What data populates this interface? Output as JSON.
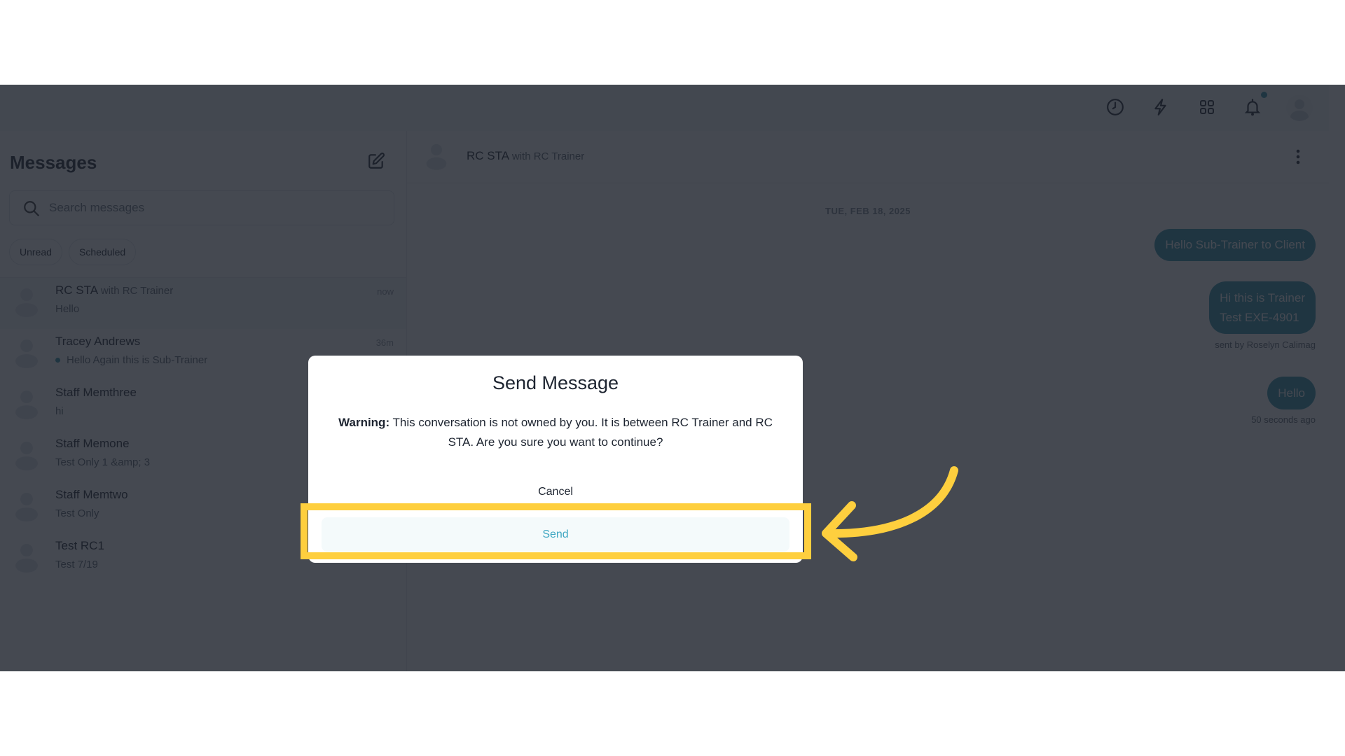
{
  "topbar": {
    "icons": [
      "history-clock-icon",
      "lightning-bolt-icon",
      "apps-grid-icon",
      "notifications-bell-icon",
      "user-avatar"
    ],
    "notification_badge": true
  },
  "sidebar": {
    "title": "Messages",
    "search": {
      "placeholder": "Search messages",
      "value": ""
    },
    "filters": [
      "Unread",
      "Scheduled"
    ],
    "conversations": [
      {
        "name": "RC STA",
        "with": "with RC Trainer",
        "preview": "Hello",
        "time": "now",
        "selected": true,
        "unread": false
      },
      {
        "name": "Tracey Andrews",
        "with": "",
        "preview": "Hello Again this is Sub-Trainer",
        "time": "36m",
        "selected": false,
        "unread": true
      },
      {
        "name": "Staff Memthree",
        "with": "",
        "preview": "hi",
        "time": "",
        "selected": false,
        "unread": false
      },
      {
        "name": "Staff Memone",
        "with": "",
        "preview": "Test Only 1 &amp; 3",
        "time": "",
        "selected": false,
        "unread": false
      },
      {
        "name": "Staff Memtwo",
        "with": "",
        "preview": "Test Only",
        "time": "",
        "selected": false,
        "unread": false
      },
      {
        "name": "Test RC1",
        "with": "",
        "preview": "Test 7/19",
        "time": "",
        "selected": false,
        "unread": false
      }
    ]
  },
  "chat": {
    "title": "RC STA",
    "title_with": "with RC Trainer",
    "date": "TUE, FEB 18, 2025",
    "messages": [
      {
        "lines": [
          "Hello Sub-Trainer to Client"
        ],
        "meta": ""
      },
      {
        "lines": [
          "Hi this is Trainer",
          "Test EXE-4901"
        ],
        "meta": "sent by Roselyn Calimag"
      },
      {
        "lines": [
          "Hello"
        ],
        "meta": "50 seconds ago"
      }
    ]
  },
  "modal": {
    "title": "Send Message",
    "warning_label": "Warning:",
    "warning_text": " This conversation is not owned by you. It is between RC Trainer and RC STA. Are you sure you want to continue?",
    "cancel_label": "Cancel",
    "send_label": "Send"
  },
  "annotation": {
    "highlight_color": "#fecf3e",
    "target": "send-button"
  },
  "colors": {
    "accent": "#2d8fa8",
    "send_text": "#3fa7c2"
  }
}
